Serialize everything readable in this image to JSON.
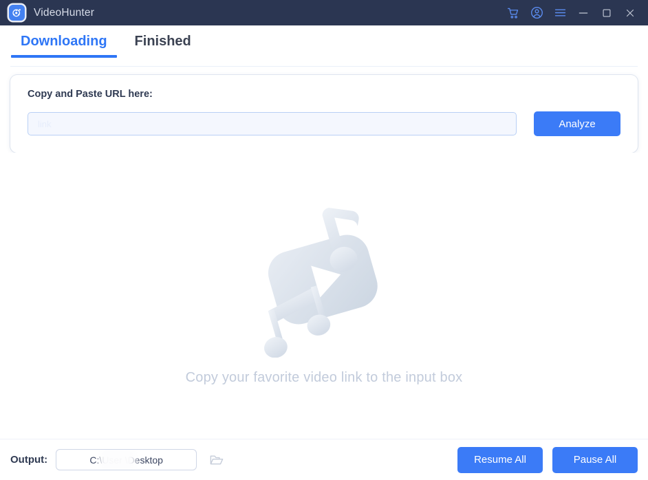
{
  "window": {
    "app_name": "VideoHunter",
    "app_icon": "videohunter-logo-icon",
    "controls": [
      {
        "name": "cart-icon",
        "label": "Cart"
      },
      {
        "name": "account-icon",
        "label": "Account"
      },
      {
        "name": "menu-icon",
        "label": "Menu"
      },
      {
        "name": "minimize-icon",
        "label": "Minimize"
      },
      {
        "name": "maximize-icon",
        "label": "Maximize"
      },
      {
        "name": "close-icon",
        "label": "Close"
      }
    ]
  },
  "tabs": [
    {
      "label": "Downloading",
      "active": true
    },
    {
      "label": "Finished",
      "active": false
    }
  ],
  "url_card": {
    "label": "Copy and Paste URL here:",
    "input_placeholder": "link",
    "input_value": "",
    "analyze_label": "Analyze"
  },
  "empty_state": {
    "illustration": "video-music-placeholder-illustration",
    "message": "Copy your favorite video link to the input box"
  },
  "output_bar": {
    "label": "Output:",
    "path": "C:\\User        \\Desktop",
    "path_prefix": "C:\\User",
    "path_suffix": "\\Desktop",
    "browse_icon": "folder-open-icon",
    "resume_all_label": "Resume All",
    "pause_all_label": "Pause All"
  },
  "colors": {
    "titlebar": "#2b3652",
    "accent": "#3b7bf7",
    "tab_active": "#2e76f6",
    "text_dark": "#2f3a52",
    "hint_text": "#c2cbdb",
    "input_bg": "#f4f7fe",
    "input_border": "#b9d0f5",
    "page_bg": "#ffffff"
  }
}
